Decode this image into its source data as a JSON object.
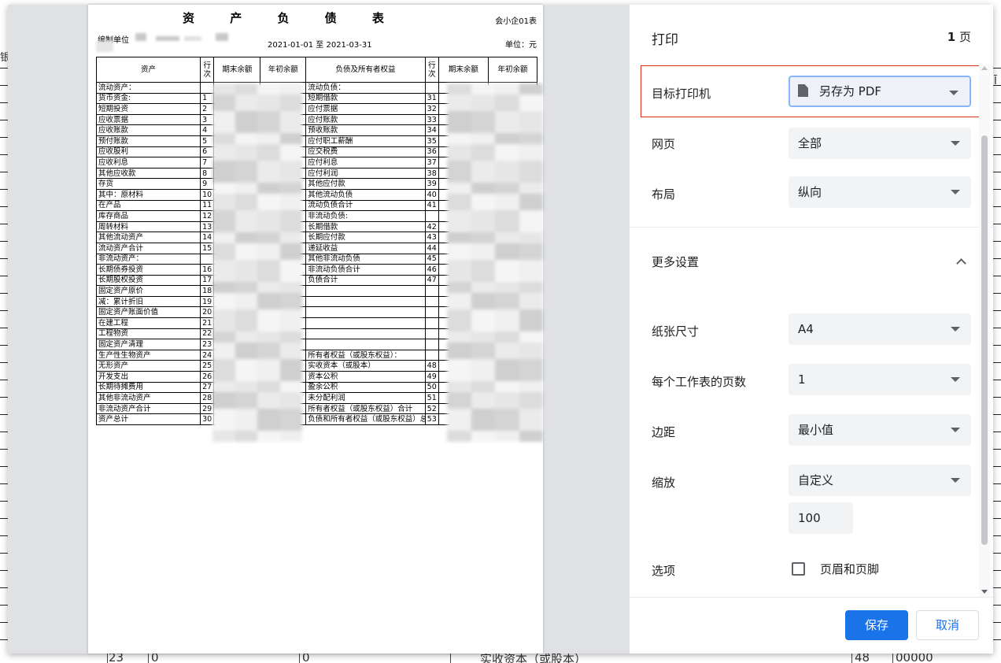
{
  "dialog": {
    "title": "打印",
    "page_count_num": "1",
    "page_count_unit": "页",
    "destination_label": "目标打印机",
    "destination_value": "另存为 PDF",
    "pages_label": "网页",
    "pages_value": "全部",
    "layout_label": "布局",
    "layout_value": "纵向",
    "more_settings_label": "更多设置",
    "paper_size_label": "纸张尺寸",
    "paper_size_value": "A4",
    "pages_per_sheet_label": "每个工作表的页数",
    "pages_per_sheet_value": "1",
    "margins_label": "边距",
    "margins_value": "最小值",
    "scale_label": "缩放",
    "scale_value": "自定义",
    "scale_input_value": "100",
    "options_label": "选项",
    "header_footer_label": "页眉和页脚",
    "save_label": "保存",
    "cancel_label": "取消",
    "accent_color": "#1a73e8",
    "highlight_color": "#e0301e"
  },
  "sheet": {
    "title": "资 产 负 债 表",
    "form_code": "会小企01表",
    "unit_label": "编制单位",
    "period": "2021-01-01 至 2021-03-31",
    "currency": "单位：元",
    "headers": [
      "资产",
      "行次",
      "期末余额",
      "年初余额",
      "负债及所有者权益",
      "行次",
      "期末余额",
      "年初余额"
    ],
    "rows": [
      {
        "a": "流动资产：",
        "an": "",
        "l": "流动负债：",
        "ln": "",
        "ai": 0,
        "li": 0
      },
      {
        "a": "货币资金:",
        "an": "1",
        "l": "短期借款",
        "ln": "31",
        "ai": 1,
        "li": 1
      },
      {
        "a": "短期投资",
        "an": "2",
        "l": "应付票据",
        "ln": "32",
        "ai": 1,
        "li": 1
      },
      {
        "a": "应收票据",
        "an": "3",
        "l": "应付账款",
        "ln": "33",
        "ai": 1,
        "li": 1
      },
      {
        "a": "应收账款",
        "an": "4",
        "l": "预收账款",
        "ln": "34",
        "ai": 1,
        "li": 1
      },
      {
        "a": "预付账款",
        "an": "5",
        "l": "应付职工薪酬",
        "ln": "35",
        "ai": 1,
        "li": 1
      },
      {
        "a": "应收股利",
        "an": "6",
        "l": "应交税费",
        "ln": "36",
        "ai": 1,
        "li": 1
      },
      {
        "a": "应收利息",
        "an": "7",
        "l": "应付利息",
        "ln": "37",
        "ai": 1,
        "li": 1
      },
      {
        "a": "其他应收款",
        "an": "8",
        "l": "应付利润",
        "ln": "38",
        "ai": 1,
        "li": 1
      },
      {
        "a": "存货",
        "an": "9",
        "l": "其他应付款",
        "ln": "39",
        "ai": 1,
        "li": 1
      },
      {
        "a": "其中：原材料",
        "an": "10",
        "l": "其他流动负债",
        "ln": "40",
        "ai": 1,
        "li": 1
      },
      {
        "a": "在产品",
        "an": "11",
        "l": "流动负债合计",
        "ln": "41",
        "ai": 1,
        "li": 1
      },
      {
        "a": "库存商品",
        "an": "12",
        "l": "非流动负债:",
        "ln": "",
        "ai": 1,
        "li": 0
      },
      {
        "a": "周转材料",
        "an": "13",
        "l": "长期借款",
        "ln": "42",
        "ai": 1,
        "li": 1
      },
      {
        "a": "其他流动资产",
        "an": "14",
        "l": "长期应付款",
        "ln": "43",
        "ai": 1,
        "li": 1
      },
      {
        "a": "流动资产合计",
        "an": "15",
        "l": "递延收益",
        "ln": "44",
        "ai": 1,
        "li": 1
      },
      {
        "a": "非流动资产：",
        "an": "",
        "l": "其他非流动负债",
        "ln": "45",
        "ai": 0,
        "li": 2
      },
      {
        "a": "长期债券投资",
        "an": "16",
        "l": "非流动负债合计",
        "ln": "46",
        "ai": 1,
        "li": 0
      },
      {
        "a": "长期股权投资",
        "an": "17",
        "l": "负债合计",
        "ln": "47",
        "ai": 1,
        "li": 1
      },
      {
        "a": "固定资产原价",
        "an": "18",
        "l": "",
        "ln": "",
        "ai": 1,
        "li": 0
      },
      {
        "a": "减：累计折旧",
        "an": "19",
        "l": "",
        "ln": "",
        "ai": 1,
        "li": 0
      },
      {
        "a": "固定资产账面价值",
        "an": "20",
        "l": "",
        "ln": "",
        "ai": 1,
        "li": 0
      },
      {
        "a": "在建工程",
        "an": "21",
        "l": "",
        "ln": "",
        "ai": 1,
        "li": 0
      },
      {
        "a": "工程物资",
        "an": "22",
        "l": "",
        "ln": "",
        "ai": 1,
        "li": 0
      },
      {
        "a": "固定资产清理",
        "an": "23",
        "l": "",
        "ln": "",
        "ai": 1,
        "li": 0
      },
      {
        "a": "生产性生物资产",
        "an": "24",
        "l": "所有者权益（或股东权益）：",
        "ln": "",
        "ai": 1,
        "li": 0
      },
      {
        "a": "无形资产",
        "an": "25",
        "l": "实收资本（或股本）",
        "ln": "48",
        "ai": 1,
        "li": 1
      },
      {
        "a": "开发支出",
        "an": "26",
        "l": "资本公积",
        "ln": "49",
        "ai": 1,
        "li": 0
      },
      {
        "a": "长期待摊费用",
        "an": "27",
        "l": "盈余公积",
        "ln": "50",
        "ai": 1,
        "li": 0
      },
      {
        "a": "其他非流动资产",
        "an": "28",
        "l": "未分配利润",
        "ln": "51",
        "ai": 1,
        "li": 1
      },
      {
        "a": "非流动资产合计",
        "an": "29",
        "l": "所有者权益（或股东权益）合计",
        "ln": "52",
        "ai": 1,
        "li": 0
      }
    ],
    "total_row": {
      "a": "资产总计",
      "an": "30",
      "l": "负债和所有者权益（或股东权益）总计",
      "ln": "53"
    }
  },
  "background": {
    "left_fragment": "银",
    "right_fragment": "Ī",
    "bottom_row": [
      "23",
      "0",
      "0",
      "实收资本（或股本）",
      "48",
      "00000"
    ]
  }
}
